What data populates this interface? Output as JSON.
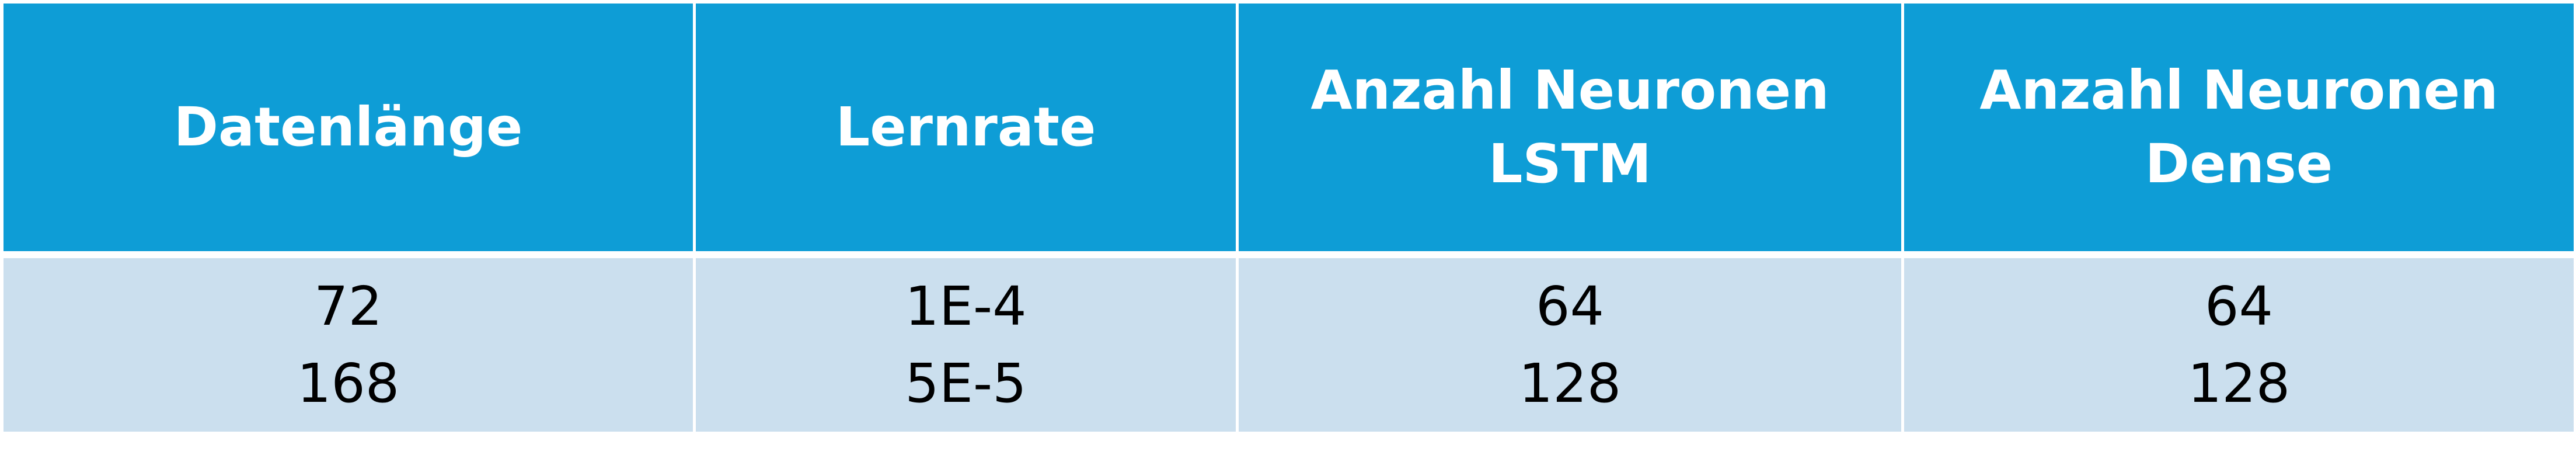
{
  "table": {
    "headers": [
      [
        "Datenlänge"
      ],
      [
        "Lernrate"
      ],
      [
        "Anzahl Neuronen",
        "LSTM"
      ],
      [
        "Anzahl Neuronen",
        "Dense"
      ]
    ],
    "rows": [
      [
        [
          "72",
          "168"
        ],
        [
          "1E-4",
          "5E-5"
        ],
        [
          "64",
          "128"
        ],
        [
          "64",
          "128"
        ]
      ]
    ],
    "colors": {
      "header_bg": "#0e9dd6",
      "header_text": "#ffffff",
      "body_bg": "#cbdfee",
      "body_text": "#000000"
    }
  }
}
